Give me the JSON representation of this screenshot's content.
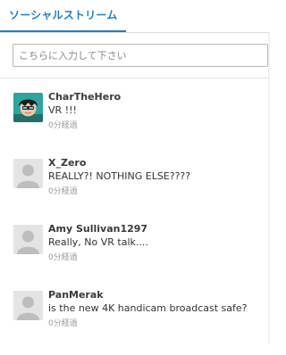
{
  "tab": {
    "label": "ソーシャルストリーム"
  },
  "search": {
    "placeholder": "こちらに入力して下さい"
  },
  "posts": [
    {
      "user": "CharTheHero",
      "message": "VR !!!",
      "time": "0分経過",
      "avatar": "character-avatar"
    },
    {
      "user": "X_Zero",
      "message": "REALLY?! NOTHING ELSE????",
      "time": "0分経過",
      "avatar": "default-avatar"
    },
    {
      "user": "Amy Sullivan1297",
      "message": "Really, No VR talk....",
      "time": "0分経過",
      "avatar": "default-avatar"
    },
    {
      "user": "PanMerak",
      "message": "is the new 4K handicam broadcast safe?",
      "time": "0分経過",
      "avatar": "default-avatar"
    }
  ],
  "colors": {
    "accent": "#1e7ec8",
    "muted": "#9a9a9a"
  }
}
